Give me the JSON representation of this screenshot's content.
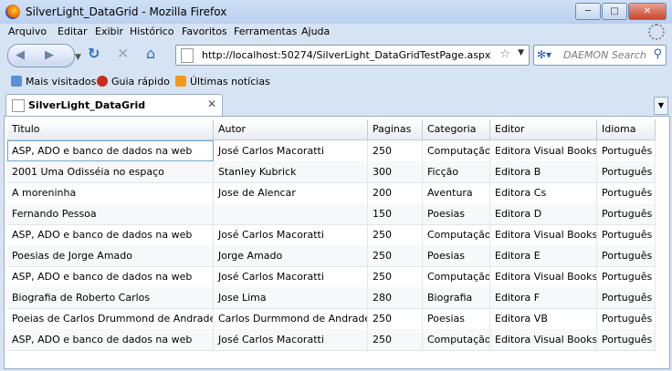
{
  "window": {
    "title": "SilverLight_DataGrid - Mozilla Firefox"
  },
  "menu": [
    "Arquivo",
    "Editar",
    "Exibir",
    "Histórico",
    "Favoritos",
    "Ferramentas",
    "Ajuda"
  ],
  "nav": {
    "url": "http://localhost:50274/SilverLight_DataGridTestPage.aspx",
    "search_placeholder": "DAEMON Search"
  },
  "bookmarks": [
    "Mais visitados",
    "Guia rápido",
    "Últimas notícias"
  ],
  "tab": {
    "label": "SilverLight_DataGrid"
  },
  "grid": {
    "columns": [
      "Titulo",
      "Autor",
      "Paginas",
      "Categoria",
      "Editor",
      "Idioma"
    ],
    "rows": [
      [
        "ASP, ADO e banco de dados na web",
        "José Carlos Macoratti",
        "250",
        "Computação",
        "Editora Visual Books",
        "Português"
      ],
      [
        "2001 Uma Odisséia no espaço",
        "Stanley Kubrick",
        "300",
        "Ficção",
        "Editora B",
        "Português"
      ],
      [
        "A moreninha",
        "Jose de Alencar",
        "200",
        "Aventura",
        "Editora Cs",
        "Português"
      ],
      [
        "Fernando Pessoa",
        "",
        "150",
        "Poesias",
        "Editora D",
        "Português"
      ],
      [
        "ASP, ADO e banco de dados na web",
        "José Carlos Macoratti",
        "250",
        "Computação",
        "Editora Visual Books",
        "Português"
      ],
      [
        "Poesias de Jorge Amado",
        "Jorge Amado",
        "250",
        "Poesias",
        "Editora E",
        "Português"
      ],
      [
        "ASP, ADO e banco de dados na web",
        "José Carlos Macoratti",
        "250",
        "Computação",
        "Editora Visual Books",
        "Português"
      ],
      [
        "Biografia de Roberto Carlos",
        "Jose Lima",
        "280",
        "Biografia",
        "Editora F",
        "Português"
      ],
      [
        "Poeias de Carlos Drummond de Andrade",
        "Carlos Durmmond de Andrade",
        "250",
        "Poesias",
        "Editora VB",
        "Português"
      ],
      [
        "ASP, ADO e banco de dados na web",
        "José Carlos Macoratti",
        "250",
        "Computação",
        "Editora Visual Books",
        "Português"
      ]
    ]
  }
}
